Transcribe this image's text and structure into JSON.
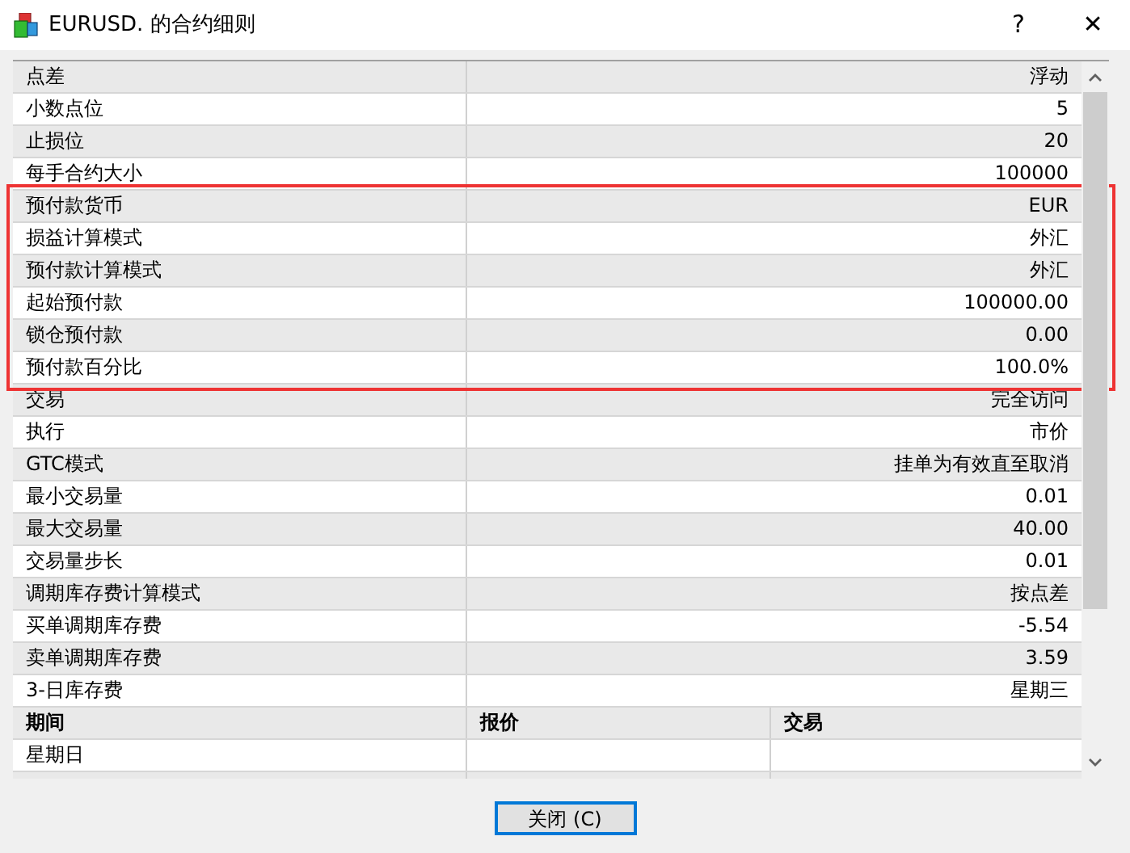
{
  "window": {
    "title": "EURUSD. 的合约细则",
    "help": "?",
    "close": "✕"
  },
  "groups": [
    {
      "highlighted": false,
      "rows": [
        {
          "label": "点差",
          "value": "浮动"
        },
        {
          "label": "小数点位",
          "value": "5"
        },
        {
          "label": "止损位",
          "value": "20"
        },
        {
          "label": "每手合约大小",
          "value": "100000"
        }
      ]
    },
    {
      "highlighted": true,
      "rows": [
        {
          "label": "预付款货币",
          "value": "EUR"
        },
        {
          "label": "损益计算模式",
          "value": "外汇"
        },
        {
          "label": "预付款计算模式",
          "value": "外汇"
        },
        {
          "label": "起始预付款",
          "value": "100000.00"
        },
        {
          "label": "锁仓预付款",
          "value": "0.00"
        },
        {
          "label": "预付款百分比",
          "value": "100.0%"
        }
      ]
    },
    {
      "highlighted": false,
      "rows": [
        {
          "label": "交易",
          "value": "完全访问"
        },
        {
          "label": "执行",
          "value": "市价"
        },
        {
          "label": "GTC模式",
          "value": "挂单为有效直至取消"
        },
        {
          "label": "最小交易量",
          "value": "0.01"
        },
        {
          "label": "最大交易量",
          "value": "40.00"
        },
        {
          "label": "交易量步长",
          "value": "0.01"
        },
        {
          "label": "调期库存费计算模式",
          "value": "按点差"
        },
        {
          "label": "买单调期库存费",
          "value": "-5.54"
        },
        {
          "label": "卖单调期库存费",
          "value": "3.59"
        },
        {
          "label": "3-日库存费",
          "value": "星期三"
        }
      ]
    }
  ],
  "sessions": {
    "columns": [
      "期间",
      "报价",
      "交易"
    ],
    "rows": [
      {
        "period": "星期日"
      }
    ]
  },
  "buttons": [
    {
      "label": "关闭 (C)"
    }
  ]
}
